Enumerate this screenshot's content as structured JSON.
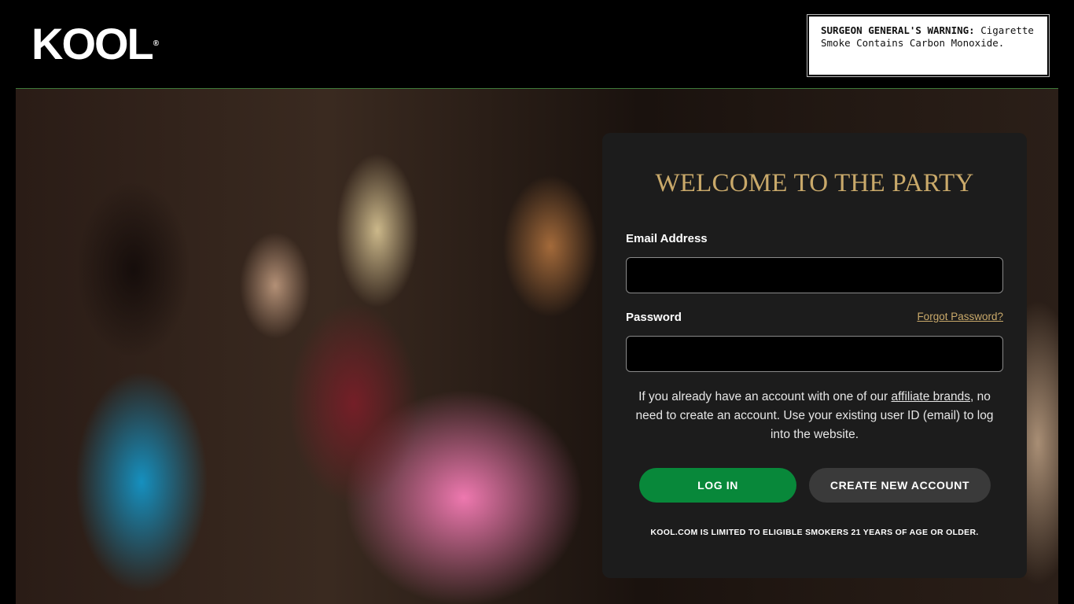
{
  "header": {
    "logo_text": "KOOL",
    "logo_mark": "®",
    "warning_heading": "SURGEON GENERAL'S WARNING:",
    "warning_text_line1": "Cigarette",
    "warning_text_line2": "Smoke Contains Carbon Monoxide."
  },
  "login": {
    "title": "WELCOME TO THE PARTY",
    "email_label": "Email Address",
    "email_value": "",
    "password_label": "Password",
    "password_value": "",
    "forgot_link": "Forgot Password?",
    "note_before": "If you already have an account with one of our ",
    "note_link": "affiliate brands",
    "note_after": ", no need to create an account. Use your existing user ID (email) to log into the website.",
    "login_button": "LOG IN",
    "create_button": "CREATE NEW ACCOUNT",
    "legal": "KOOL.COM IS LIMITED TO ELIGIBLE SMOKERS 21 YEARS OF AGE OR OLDER."
  },
  "colors": {
    "accent_gold": "#c9a96a",
    "login_green": "#08883a",
    "card_bg": "#1c1c1c"
  }
}
